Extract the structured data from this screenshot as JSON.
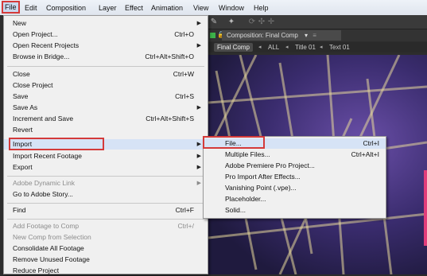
{
  "menubar": {
    "items": [
      "File",
      "Edit",
      "Composition",
      "Layer",
      "Effect",
      "Animation",
      "View",
      "Window",
      "Help"
    ]
  },
  "composition_panel": {
    "tab_label": "Composition: Final Comp",
    "breadcrumbs": [
      "Final Comp",
      "ALL",
      "Title 01",
      "Text 01"
    ]
  },
  "file_menu": {
    "items": [
      {
        "label": "New",
        "shortcut": "",
        "submenu": true,
        "disabled": false
      },
      {
        "label": "Open Project...",
        "shortcut": "Ctrl+O",
        "submenu": false,
        "disabled": false
      },
      {
        "label": "Open Recent Projects",
        "shortcut": "",
        "submenu": true,
        "disabled": false
      },
      {
        "label": "Browse in Bridge...",
        "shortcut": "Ctrl+Alt+Shift+O",
        "submenu": false,
        "disabled": false
      },
      {
        "label": "Close",
        "shortcut": "Ctrl+W",
        "submenu": false,
        "disabled": false
      },
      {
        "label": "Close Project",
        "shortcut": "",
        "submenu": false,
        "disabled": false
      },
      {
        "label": "Save",
        "shortcut": "Ctrl+S",
        "submenu": false,
        "disabled": false
      },
      {
        "label": "Save As",
        "shortcut": "",
        "submenu": true,
        "disabled": false
      },
      {
        "label": "Increment and Save",
        "shortcut": "Ctrl+Alt+Shift+S",
        "submenu": false,
        "disabled": false
      },
      {
        "label": "Revert",
        "shortcut": "",
        "submenu": false,
        "disabled": false
      },
      {
        "label": "Import",
        "shortcut": "",
        "submenu": true,
        "disabled": false
      },
      {
        "label": "Import Recent Footage",
        "shortcut": "",
        "submenu": true,
        "disabled": false
      },
      {
        "label": "Export",
        "shortcut": "",
        "submenu": true,
        "disabled": false
      },
      {
        "label": "Adobe Dynamic Link",
        "shortcut": "",
        "submenu": true,
        "disabled": true
      },
      {
        "label": "Go to Adobe Story...",
        "shortcut": "",
        "submenu": false,
        "disabled": false
      },
      {
        "label": "Find",
        "shortcut": "Ctrl+F",
        "submenu": false,
        "disabled": false
      },
      {
        "label": "Add Footage to Comp",
        "shortcut": "Ctrl+/",
        "submenu": false,
        "disabled": true
      },
      {
        "label": "New Comp from Selection",
        "shortcut": "",
        "submenu": false,
        "disabled": true
      },
      {
        "label": "Consolidate All Footage",
        "shortcut": "",
        "submenu": false,
        "disabled": false
      },
      {
        "label": "Remove Unused Footage",
        "shortcut": "",
        "submenu": false,
        "disabled": false
      },
      {
        "label": "Reduce Project",
        "shortcut": "",
        "submenu": false,
        "disabled": false
      }
    ]
  },
  "import_submenu": {
    "items": [
      {
        "label": "File...",
        "shortcut": "Ctrl+I"
      },
      {
        "label": "Multiple Files...",
        "shortcut": "Ctrl+Alt+I"
      },
      {
        "label": "Adobe Premiere Pro Project...",
        "shortcut": ""
      },
      {
        "label": "Pro Import After Effects...",
        "shortcut": ""
      },
      {
        "label": "Vanishing Point (.vpe)...",
        "shortcut": ""
      },
      {
        "label": "Placeholder...",
        "shortcut": ""
      },
      {
        "label": "Solid...",
        "shortcut": ""
      }
    ]
  },
  "colors": {
    "highlight_box": "#d43a3a",
    "menu_highlight": "#d6e3f6",
    "viewer_accent": "#e23d7a"
  }
}
